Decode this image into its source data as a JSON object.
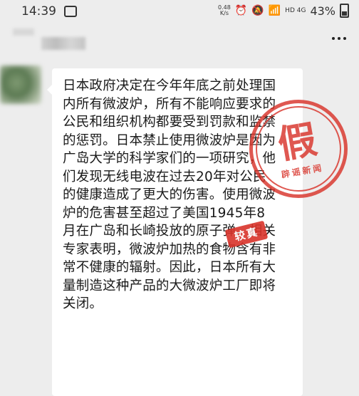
{
  "status_bar": {
    "time": "14:39",
    "net_speed": "0.48\nK/s",
    "signal_labels": "HD 4G",
    "battery_percent": "43%"
  },
  "header": {
    "title_obscured": true,
    "more_icon": "more-dots-icon"
  },
  "message": {
    "text": "日本政府决定在今年年底之前处理国\n内所有微波炉，所有不能响应要求的\n公民和组织机构都要受到罚款和监禁\n的惩罚。日本禁止使用微波炉是因为\n广岛大学的科学家们的一项研究，他\n们发现无线电波在过去20年对公民\n的健康造成了更大的伤害。使用微波\n炉的危害甚至超过了美国1945年8\n月在广岛和长崎投放的原子弹。相关\n专家表明，微波炉加热的食物含有非\n常不健康的辐射。因此，日本所有大\n量制造这种产品的大微波炉工厂即将\n关闭。"
  },
  "stamp": {
    "main_char": "假",
    "ring_text": "辟谣新闻",
    "badge_text": "较真",
    "color": "#d9342b"
  }
}
